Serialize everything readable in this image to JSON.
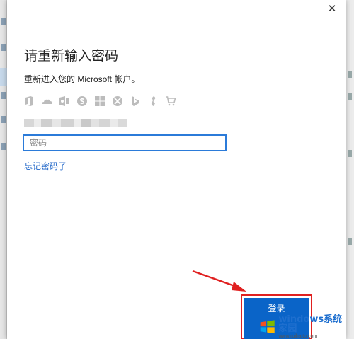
{
  "dialog": {
    "close_label": "✕",
    "title": "请重新输入密码",
    "subtitle": "重新进入您的 Microsoft 帐户。",
    "service_icons": [
      "office-icon",
      "onedrive-icon",
      "outlook-icon",
      "skype-icon",
      "windows-icon",
      "xbox-icon",
      "bing-icon",
      "msn-icon",
      "store-icon"
    ],
    "password": {
      "placeholder": "密码",
      "value": ""
    },
    "forgot_label": "忘记密码了",
    "login_label": "登录"
  },
  "watermark": {
    "brand": "windows系统家园",
    "url": "www.ruihaitu.com"
  },
  "colors": {
    "accent": "#0a64c8",
    "link": "#1a62c7",
    "highlight": "#e02020"
  }
}
